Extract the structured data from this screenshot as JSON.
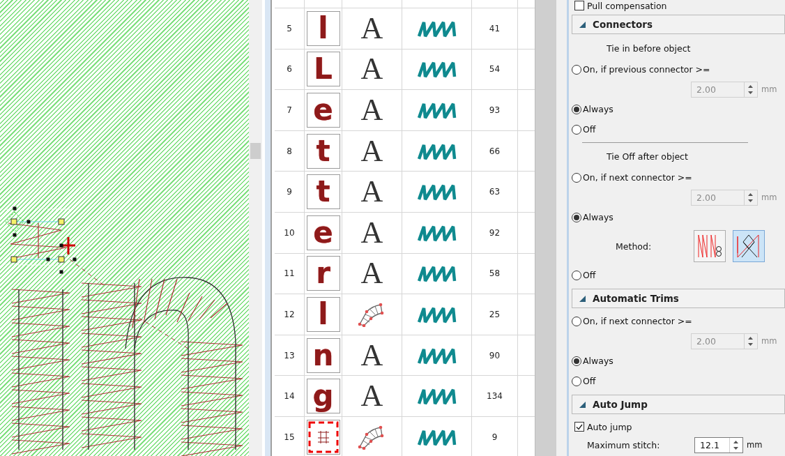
{
  "object_list": {
    "rows": [
      {
        "number": "5",
        "thumbnail": {
          "kind": "letter",
          "glyph": "l"
        },
        "object": {
          "kind": "lettering",
          "glyph": "A"
        },
        "stitch": {
          "kind": "zigzag"
        },
        "count": "41"
      },
      {
        "number": "6",
        "thumbnail": {
          "kind": "letter",
          "glyph": "L"
        },
        "object": {
          "kind": "lettering",
          "glyph": "A"
        },
        "stitch": {
          "kind": "zigzag"
        },
        "count": "54"
      },
      {
        "number": "7",
        "thumbnail": {
          "kind": "letter",
          "glyph": "e"
        },
        "object": {
          "kind": "lettering",
          "glyph": "A"
        },
        "stitch": {
          "kind": "zigzag"
        },
        "count": "93"
      },
      {
        "number": "8",
        "thumbnail": {
          "kind": "letter",
          "glyph": "t"
        },
        "object": {
          "kind": "lettering",
          "glyph": "A"
        },
        "stitch": {
          "kind": "zigzag"
        },
        "count": "66"
      },
      {
        "number": "9",
        "thumbnail": {
          "kind": "letter",
          "glyph": "t"
        },
        "object": {
          "kind": "lettering",
          "glyph": "A"
        },
        "stitch": {
          "kind": "zigzag"
        },
        "count": "63"
      },
      {
        "number": "10",
        "thumbnail": {
          "kind": "letter",
          "glyph": "e"
        },
        "object": {
          "kind": "lettering",
          "glyph": "A"
        },
        "stitch": {
          "kind": "zigzag"
        },
        "count": "92"
      },
      {
        "number": "11",
        "thumbnail": {
          "kind": "letter",
          "glyph": "r"
        },
        "object": {
          "kind": "lettering",
          "glyph": "A"
        },
        "stitch": {
          "kind": "zigzag"
        },
        "count": "58"
      },
      {
        "number": "12",
        "thumbnail": {
          "kind": "letter",
          "glyph": "l"
        },
        "object": {
          "kind": "arc"
        },
        "stitch": {
          "kind": "zigzag"
        },
        "count": "25"
      },
      {
        "number": "13",
        "thumbnail": {
          "kind": "letter",
          "glyph": "n"
        },
        "object": {
          "kind": "lettering",
          "glyph": "A"
        },
        "stitch": {
          "kind": "zigzag"
        },
        "count": "90"
      },
      {
        "number": "14",
        "thumbnail": {
          "kind": "letter",
          "glyph": "g"
        },
        "object": {
          "kind": "lettering",
          "glyph": "A"
        },
        "stitch": {
          "kind": "zigzag"
        },
        "count": "134"
      },
      {
        "number": "15",
        "thumbnail": {
          "kind": "connector"
        },
        "object": {
          "kind": "arc"
        },
        "stitch": {
          "kind": "zigzag"
        },
        "count": "9"
      }
    ]
  },
  "properties": {
    "top_row": {
      "label": "Pull compensation",
      "checked": false
    },
    "sections": [
      {
        "title": "Connectors",
        "expanded": true,
        "items": [
          {
            "kind": "caption",
            "text": "Tie in before object"
          },
          {
            "kind": "radio",
            "label": "On, if previous connector >=",
            "selected": false
          },
          {
            "kind": "spin",
            "value": "2.00",
            "unit": "mm",
            "disabled": true
          },
          {
            "kind": "radio",
            "label": "Always",
            "selected": true
          },
          {
            "kind": "radio",
            "label": "Off",
            "selected": false
          },
          {
            "kind": "divider"
          },
          {
            "kind": "caption",
            "text": "Tie Off after object"
          },
          {
            "kind": "radio",
            "label": "On, if next connector >=",
            "selected": false
          },
          {
            "kind": "spin",
            "value": "2.00",
            "unit": "mm",
            "disabled": true
          },
          {
            "kind": "radio",
            "label": "Always",
            "selected": true
          },
          {
            "kind": "method",
            "label": "Method:",
            "options": [
              {
                "selected": false
              },
              {
                "selected": true
              }
            ]
          },
          {
            "kind": "radio",
            "label": "Off",
            "selected": false
          }
        ]
      },
      {
        "title": "Automatic Trims",
        "expanded": true,
        "items": [
          {
            "kind": "radio",
            "label": "On, if next connector >=",
            "selected": false
          },
          {
            "kind": "spin",
            "value": "2.00",
            "unit": "mm",
            "disabled": true
          },
          {
            "kind": "radio",
            "label": "Always",
            "selected": true
          },
          {
            "kind": "radio",
            "label": "Off",
            "selected": false
          }
        ]
      },
      {
        "title": "Auto Jump",
        "expanded": true,
        "items": [
          {
            "kind": "checkbox",
            "label": "Auto jump",
            "checked": true
          },
          {
            "kind": "field",
            "label": "Maximum stitch:",
            "value": "12.1",
            "unit": "mm",
            "disabled": false
          }
        ]
      }
    ]
  }
}
